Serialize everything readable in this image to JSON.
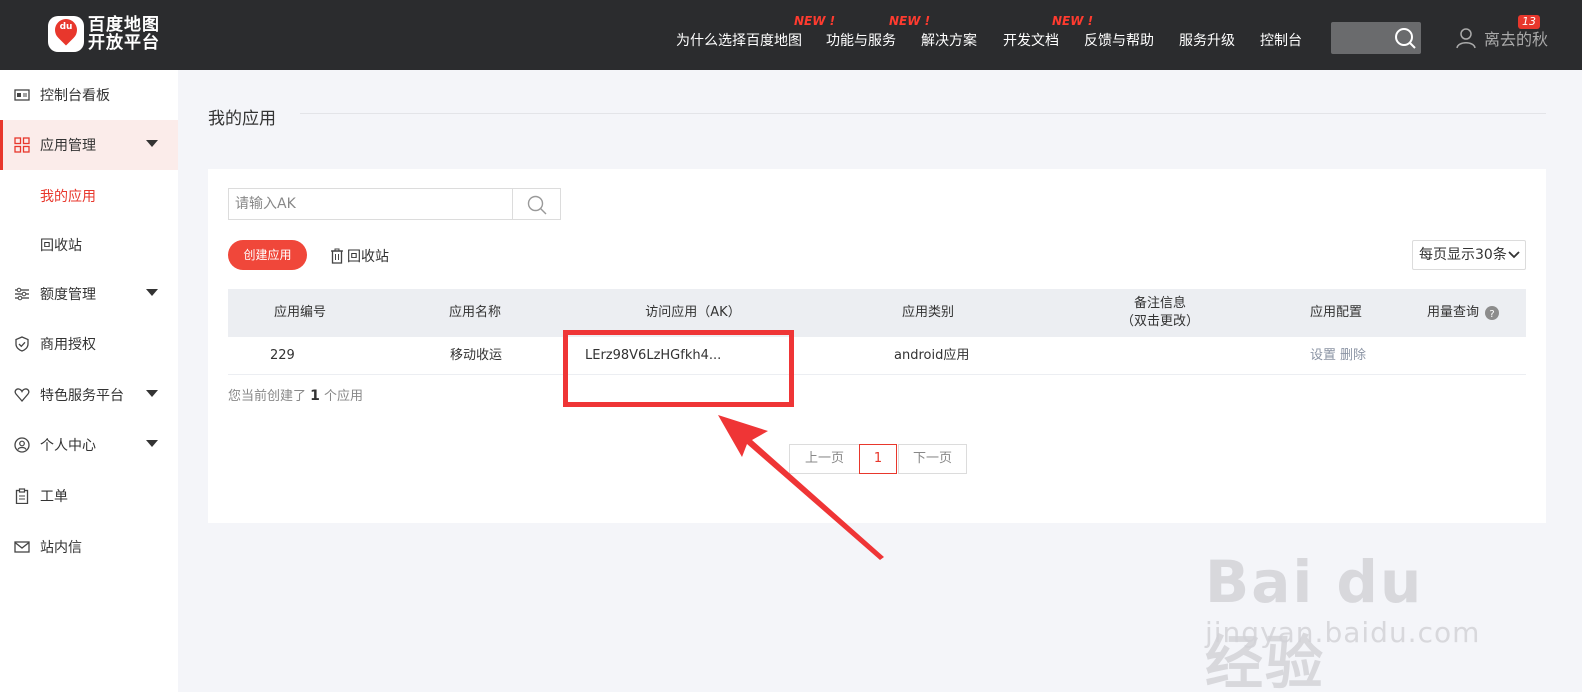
{
  "header": {
    "logo_line1": "百度地图",
    "logo_line2": "开放平台",
    "logo_pin_text": "du",
    "nav": [
      {
        "label": "为什么选择百度地图",
        "badge": ""
      },
      {
        "label": "功能与服务",
        "badge": "NEW !"
      },
      {
        "label": "解决方案",
        "badge": "NEW !"
      },
      {
        "label": "开发文档",
        "badge": ""
      },
      {
        "label": "反馈与帮助",
        "badge": "NEW !"
      },
      {
        "label": "服务升级",
        "badge": ""
      },
      {
        "label": "控制台",
        "badge": ""
      }
    ],
    "username": "离去的秋",
    "notification_count": "13"
  },
  "sidebar": {
    "items": [
      {
        "label": "控制台看板",
        "icon": "dashboard-icon"
      },
      {
        "label": "应用管理",
        "icon": "grid-icon"
      },
      {
        "label": "额度管理",
        "icon": "sliders-icon"
      },
      {
        "label": "商用授权",
        "icon": "shield-check-icon"
      },
      {
        "label": "特色服务平台",
        "icon": "heart-shield-icon"
      },
      {
        "label": "个人中心",
        "icon": "user-circle-icon"
      },
      {
        "label": "工单",
        "icon": "clipboard-icon"
      },
      {
        "label": "站内信",
        "icon": "mail-icon"
      }
    ],
    "sub_items": [
      {
        "label": "我的应用"
      },
      {
        "label": "回收站"
      }
    ]
  },
  "main": {
    "title": "我的应用",
    "search_placeholder": "请输入AK",
    "create_button": "创建应用",
    "recycle_label": "回收站",
    "per_page": "每页显示30条",
    "table": {
      "headers": [
        "应用编号",
        "应用名称",
        "访问应用（AK）",
        "应用类别",
        "备注信息",
        "（双击更改）",
        "应用配置",
        "用量查询"
      ],
      "rows": [
        {
          "id": "229",
          "name": "移动收运",
          "ak": "LErz98V6LzHGfkh4...",
          "type": "android应用",
          "note": "",
          "settings": "设置",
          "delete": "删除"
        }
      ]
    },
    "summary_prefix": "您当前创建了",
    "summary_count": "1",
    "summary_suffix": "个应用",
    "pager": {
      "prev": "上一页",
      "current": "1",
      "next": "下一页"
    }
  },
  "watermark": {
    "logo": "Bai du 经验",
    "site": "jingyan.baidu.com"
  },
  "colors": {
    "accent": "#e8372c",
    "topbar": "#2b2c2e",
    "annotation": "#ef3536"
  }
}
